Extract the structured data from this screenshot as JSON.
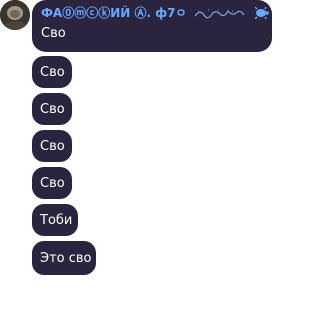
{
  "chat": {
    "sender_name": "ФА⓪ⓜⓒⓚИЙ Ⓐ. ф7ㅇ",
    "messages": [
      {
        "text": "Сво"
      },
      {
        "text": "Сво"
      },
      {
        "text": "Сво"
      },
      {
        "text": "Сво"
      },
      {
        "text": "Сво"
      },
      {
        "text": "Тоби"
      },
      {
        "text": "Это сво"
      }
    ]
  },
  "icons": {
    "avatar": "user-avatar-photo",
    "sender_decoration": "arabic-calligraphy-and-turtle-icon"
  },
  "colors": {
    "bubble_bg": "#2a243f",
    "message_text": "#ffffff",
    "sender_name": "#6aa7ff"
  }
}
